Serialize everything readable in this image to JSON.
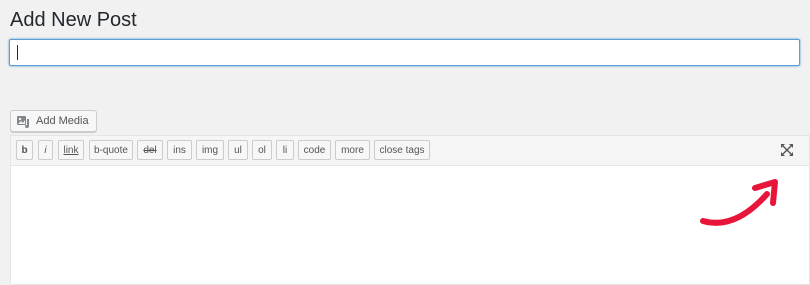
{
  "page": {
    "title": "Add New Post"
  },
  "title_field": {
    "value": "",
    "placeholder": ""
  },
  "media": {
    "add_media_label": "Add Media",
    "icon": "add-media-icon"
  },
  "toolbar": {
    "buttons": {
      "b": "b",
      "i": "i",
      "link": "link",
      "bquote": "b-quote",
      "del": "del",
      "ins": "ins",
      "img": "img",
      "ul": "ul",
      "ol": "ol",
      "li": "li",
      "code": "code",
      "more": "more",
      "close_tags": "close tags"
    },
    "fullscreen_icon": "fullscreen-icon"
  },
  "editor": {
    "content": ""
  },
  "colors": {
    "accent": "#5b9dd9",
    "annotation_arrow": "#e8153a"
  }
}
